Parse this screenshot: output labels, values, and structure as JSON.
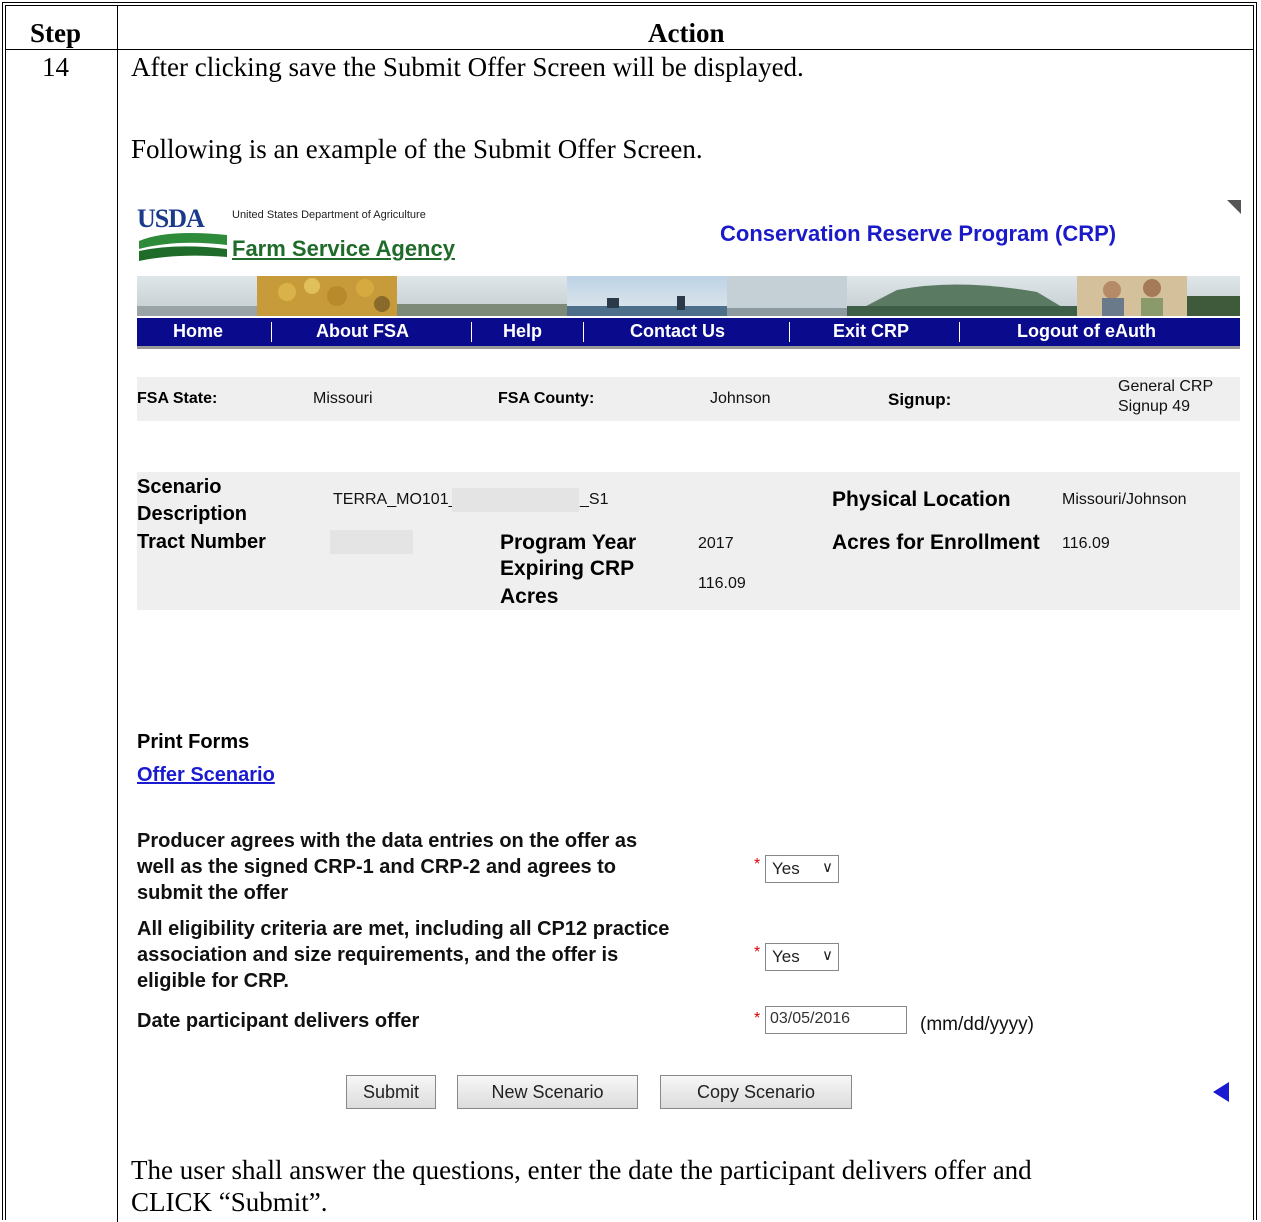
{
  "table": {
    "header_step": "Step",
    "header_action": "Action",
    "step_number": "14",
    "para1": "After clicking save the Submit Offer Screen will be displayed.",
    "para2": "Following is an example of the Submit Offer Screen.",
    "para3_line1": "The user shall answer the questions, enter the date the participant delivers offer and",
    "para3_line2": "CLICK “Submit”."
  },
  "screen": {
    "logo": {
      "usda": "USDA",
      "dept": "United States Department of Agriculture",
      "agency": "Farm Service Agency"
    },
    "title": "Conservation Reserve Program (CRP)",
    "nav": [
      "Home",
      "About FSA",
      "Help",
      "Contact Us",
      "Exit CRP",
      "Logout of eAuth"
    ],
    "info": {
      "state_label": "FSA State:",
      "state_value": "Missouri",
      "county_label": "FSA County:",
      "county_value": "Johnson",
      "signup_label": "Signup:",
      "signup_value_line1": "General CRP",
      "signup_value_line2": "Signup 49"
    },
    "scenario": {
      "desc_label_line1": "Scenario",
      "desc_label_line2": "Description",
      "desc_value_prefix": "TERRA_MO101_",
      "desc_value_suffix": "_S1",
      "location_label": "Physical Location",
      "location_value": "Missouri/Johnson",
      "tract_label": "Tract Number",
      "year_label": "Program Year",
      "year_value": "2017",
      "acres_label": "Acres for Enrollment",
      "acres_value": "116.09",
      "expiring_label_line1": "Expiring CRP",
      "expiring_label_line2": "Acres",
      "expiring_value": "116.09"
    },
    "print_forms_label": "Print Forms",
    "offer_scenario_link": "Offer Scenario",
    "q1_lines": [
      "Producer agrees with the data entries on the offer as",
      "well as the signed CRP-1 and CRP-2 and agrees to",
      "submit the offer"
    ],
    "q1_value": "Yes",
    "q2_lines": [
      "All eligibility criteria are met, including all CP12 practice",
      "association and size requirements, and the offer is",
      "eligible for CRP."
    ],
    "q2_value": "Yes",
    "q3_label": "Date participant delivers offer",
    "q3_value": "03/05/2016",
    "q3_hint": "(mm/dd/yyyy)",
    "required_mark": "*",
    "buttons": {
      "submit": "Submit",
      "new": "New Scenario",
      "copy": "Copy Scenario"
    }
  }
}
